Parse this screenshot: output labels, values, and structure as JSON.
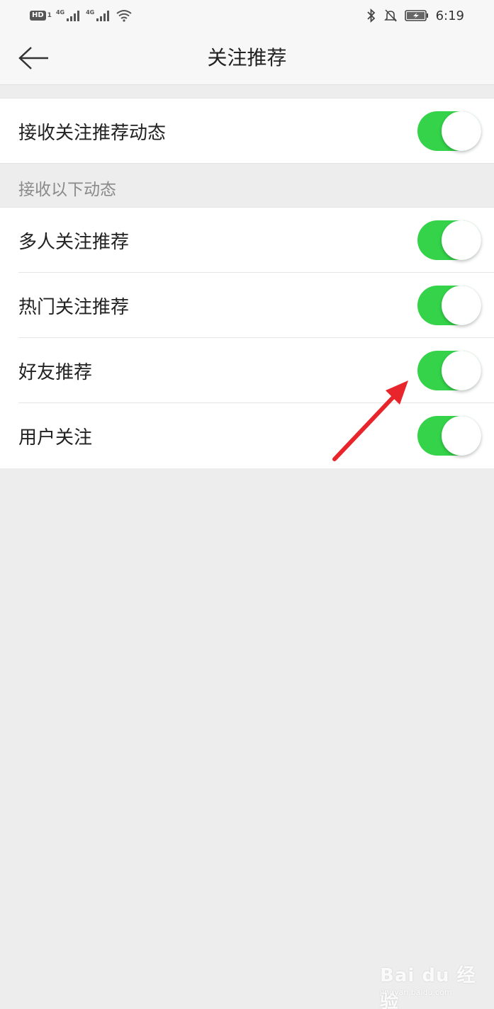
{
  "status_bar": {
    "hd_label": "HD",
    "sim_label": "1",
    "network_1": "4G",
    "network_2": "4G",
    "time": "6:19",
    "icons": [
      "signal-icon",
      "wifi-icon",
      "bluetooth-icon",
      "bell-muted-icon",
      "battery-charging-icon"
    ]
  },
  "header": {
    "title": "关注推荐",
    "back_icon": "back-arrow-icon"
  },
  "main_toggle": {
    "label": "接收关注推荐动态",
    "enabled": true
  },
  "section": {
    "header": "接收以下动态",
    "items": [
      {
        "label": "多人关注推荐",
        "enabled": true
      },
      {
        "label": "热门关注推荐",
        "enabled": true
      },
      {
        "label": "好友推荐",
        "enabled": true
      },
      {
        "label": "用户关注",
        "enabled": true
      }
    ]
  },
  "colors": {
    "toggle_on": "#34d34a",
    "annotation_arrow": "#e8252a",
    "background": "#ededed"
  },
  "watermark": {
    "text": "Bai du 经验",
    "sub": "jingyan.baidu.com"
  }
}
